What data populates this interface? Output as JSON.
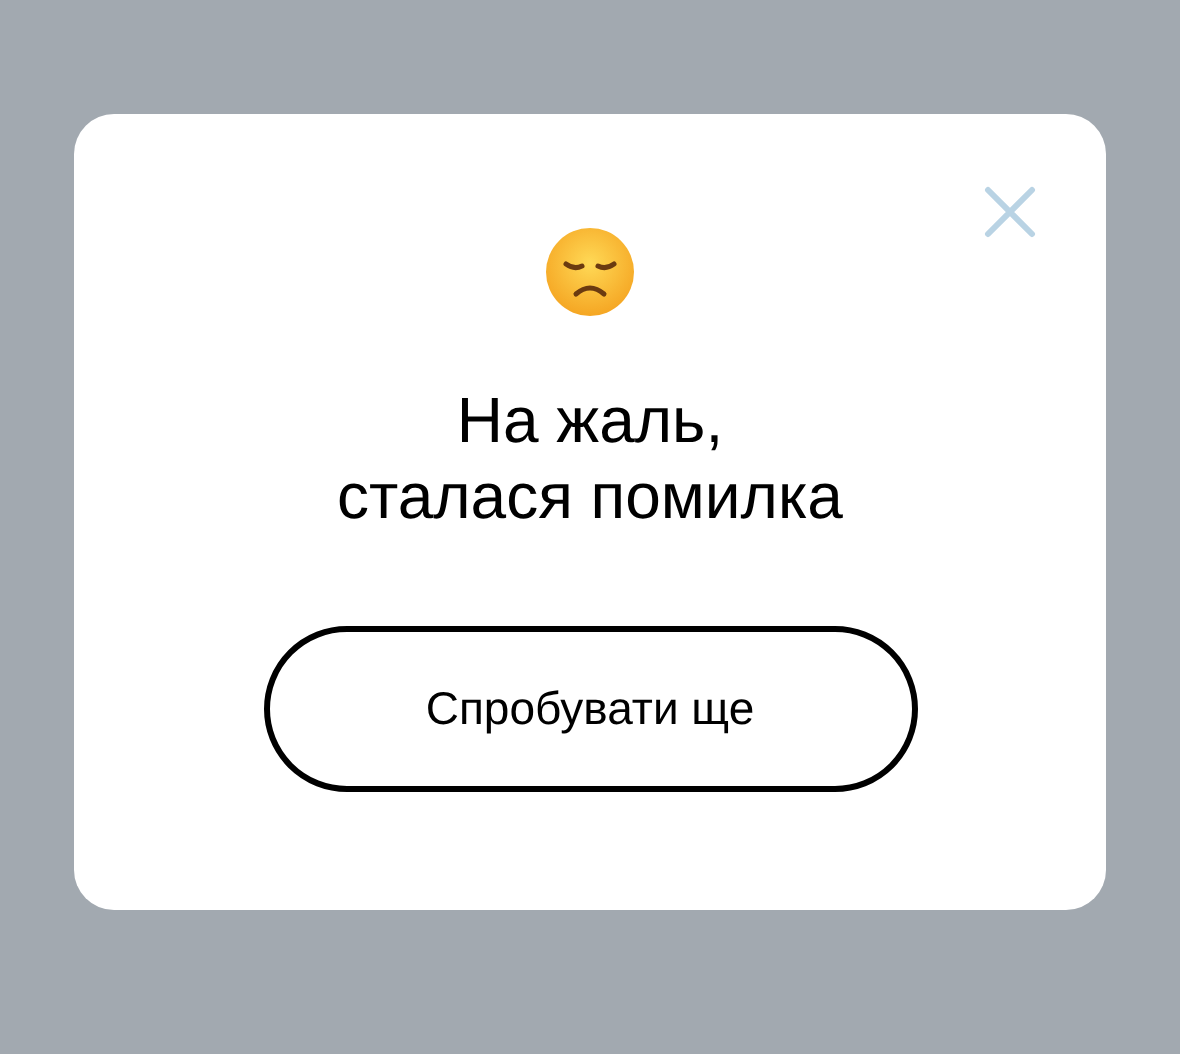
{
  "dialog": {
    "title_lines": [
      "На жаль,",
      "сталася помилка"
    ],
    "button": "Спробувати ще"
  }
}
